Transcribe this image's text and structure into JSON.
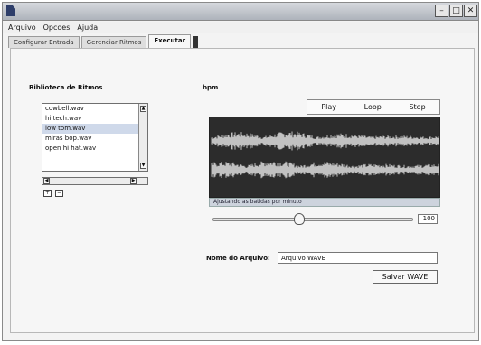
{
  "window": {
    "min_glyph": "–",
    "max_glyph": "□",
    "close_glyph": "✕"
  },
  "menu": [
    "Arquivo",
    "Opcoes",
    "Ajuda"
  ],
  "tabs": [
    {
      "label": "Configurar Entrada",
      "active": false
    },
    {
      "label": "Gerenciar Ritmos",
      "active": false
    },
    {
      "label": "Executar",
      "active": true
    }
  ],
  "library": {
    "title": "Biblioteca de Ritmos",
    "items": [
      "cowbell.wav",
      "hi tech.wav",
      "low tom.wav",
      "miras bop.wav",
      "open hi hat.wav"
    ],
    "selected_index": 2,
    "up_glyph": "▲",
    "down_glyph": "▼",
    "left_glyph": "◀",
    "right_glyph": "▶",
    "add_glyph": "+",
    "remove_glyph": "−"
  },
  "player": {
    "title": "bpm",
    "play_label": "Play",
    "loop_label": "Loop",
    "stop_label": "Stop",
    "status": "Ajustando as batidas por minuto",
    "bpm_value": "100",
    "bpm_fraction": 0.43,
    "wave_color": "#e8e8e8",
    "wave_bg": "#2c2c2c"
  },
  "save": {
    "filename_label": "Nome do Arquivo:",
    "filename_value": "Arquivo WAVE",
    "save_button": "Salvar WAVE"
  }
}
